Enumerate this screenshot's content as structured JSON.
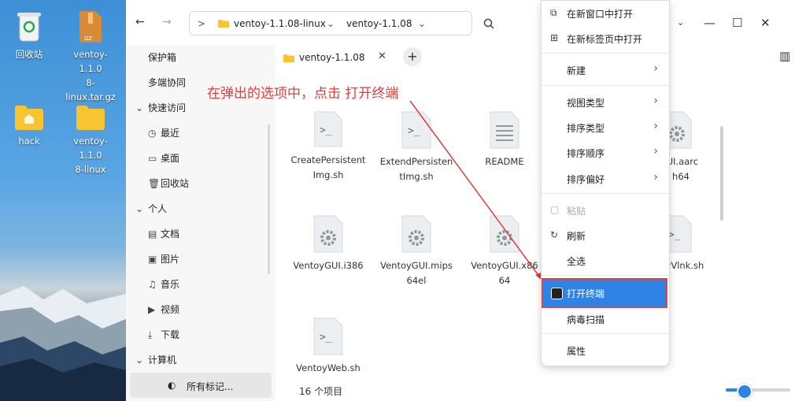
{
  "desktop": {
    "icons": [
      {
        "label": "回收站",
        "icon": "trash-icon"
      },
      {
        "label": "ventoy-1.1.08-linux.tar.gz",
        "label_line1": "ventoy-1.1.0",
        "label_line2": "8-linux.tar.gz",
        "icon": "archive-icon",
        "badge": "GZ"
      },
      {
        "label": "hack",
        "icon": "folder-icon"
      },
      {
        "label": "ventoy-1.1.08-linux",
        "label_line1": "ventoy-1.1.0",
        "label_line2": "8-linux",
        "icon": "folder-icon"
      }
    ]
  },
  "toolbar": {
    "back_icon": "←",
    "forward_icon": "→",
    "path_toggle": ">",
    "breadcrumb": [
      "ventoy-1.1.08-linux",
      "ventoy-1.1.08"
    ],
    "search_icon": "search-icon",
    "minimize": "—",
    "maximize": "☐",
    "close": "✕",
    "view_toggle": "▥"
  },
  "sidebar": {
    "items": [
      {
        "label": "保护箱"
      },
      {
        "label": "多端协同"
      },
      {
        "label": "快速访问",
        "expanded": true
      },
      {
        "label": "最近"
      },
      {
        "label": "桌面"
      },
      {
        "label": "回收站"
      },
      {
        "label": "个人",
        "expanded": true
      },
      {
        "label": "文档"
      },
      {
        "label": "图片"
      },
      {
        "label": "音乐"
      },
      {
        "label": "视频"
      },
      {
        "label": "下载"
      },
      {
        "label": "计算机",
        "expanded": true
      },
      {
        "label": "所有标记..."
      }
    ]
  },
  "tabs": [
    {
      "label": "ventoy-1.1.08",
      "active": true
    }
  ],
  "new_tab": "+",
  "files": [
    {
      "name_l1": "CreatePersistent",
      "name_l2": "Img.sh",
      "kind": "script"
    },
    {
      "name_l1": "ExtendPersisten",
      "name_l2": "tImg.sh",
      "kind": "script"
    },
    {
      "name_l1": "README",
      "name_l2": "",
      "kind": "text"
    },
    {
      "name_l1": "oyGUI.aarc",
      "name_l2": "h64",
      "kind": "binary"
    },
    {
      "name_l1": "VentoyGUI.i386",
      "name_l2": "",
      "kind": "binary"
    },
    {
      "name_l1": "VentoyGUI.mips",
      "name_l2": "64el",
      "kind": "binary"
    },
    {
      "name_l1": "VentoyGUI.x86",
      "name_l2": "64",
      "kind": "binary"
    },
    {
      "name_l1": "toyVlnk.sh",
      "name_l2": "",
      "kind": "script"
    },
    {
      "name_l1": "VentoyWeb.sh",
      "name_l2": "",
      "kind": "script"
    }
  ],
  "status": {
    "count": "16 个项目"
  },
  "annotation": "在弹出的选项中，点击 打开终端",
  "context_menu": {
    "items": [
      {
        "label": "在新窗口中打开",
        "icon": "new-window-icon"
      },
      {
        "label": "在新标签页中打开",
        "icon": "new-tab-icon"
      },
      {
        "label": "新建",
        "submenu": true
      },
      {
        "label": "视图类型",
        "submenu": true
      },
      {
        "label": "排序类型",
        "submenu": true
      },
      {
        "label": "排序顺序",
        "submenu": true
      },
      {
        "label": "排序偏好",
        "submenu": true
      },
      {
        "label": "粘贴",
        "icon": "paste-icon",
        "disabled": true
      },
      {
        "label": "刷新",
        "icon": "refresh-icon"
      },
      {
        "label": "全选"
      },
      {
        "label": "打开终端",
        "icon": "terminal-icon",
        "highlighted": true
      },
      {
        "label": "病毒扫描"
      },
      {
        "label": "属性"
      }
    ]
  },
  "colors": {
    "accent": "#2f83e6",
    "annotation": "#e23b3b",
    "folder": "#f7c531"
  }
}
